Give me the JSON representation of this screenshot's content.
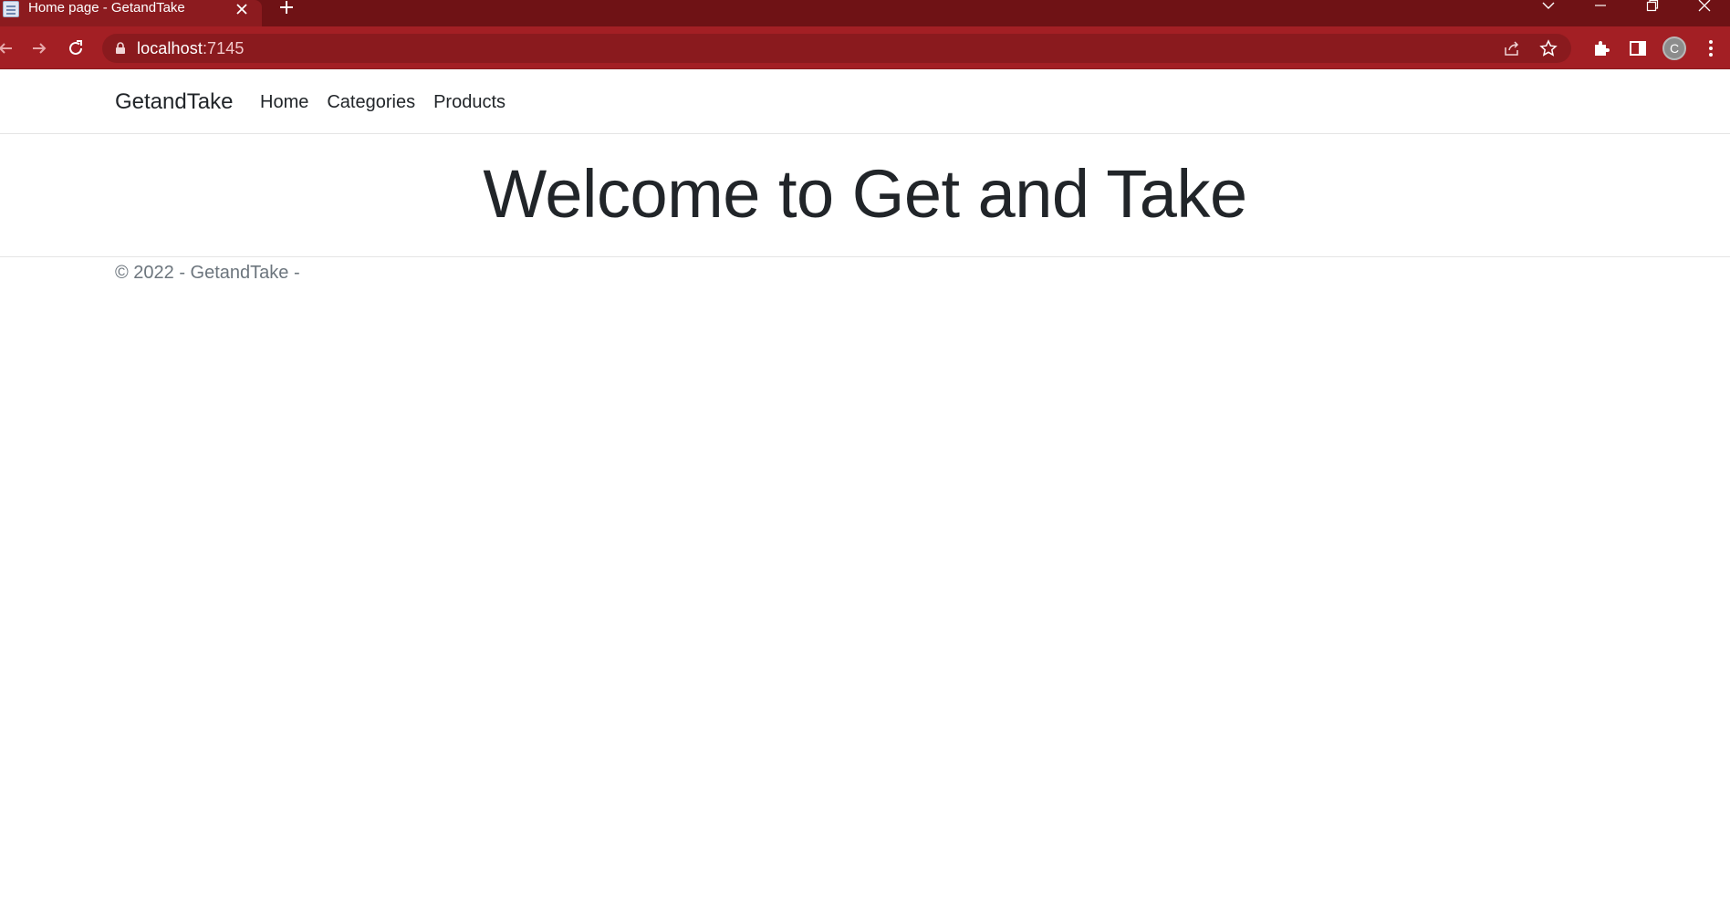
{
  "browser": {
    "tab_title": "Home page - GetandTake",
    "url_host": "localhost",
    "url_port": ":7145",
    "profile_initial": "C",
    "theme_color": "#a31f24"
  },
  "navbar": {
    "brand": "GetandTake",
    "links": [
      "Home",
      "Categories",
      "Products"
    ]
  },
  "main": {
    "heading": "Welcome to Get and Take"
  },
  "footer": {
    "text": "© 2022 - GetandTake -"
  }
}
